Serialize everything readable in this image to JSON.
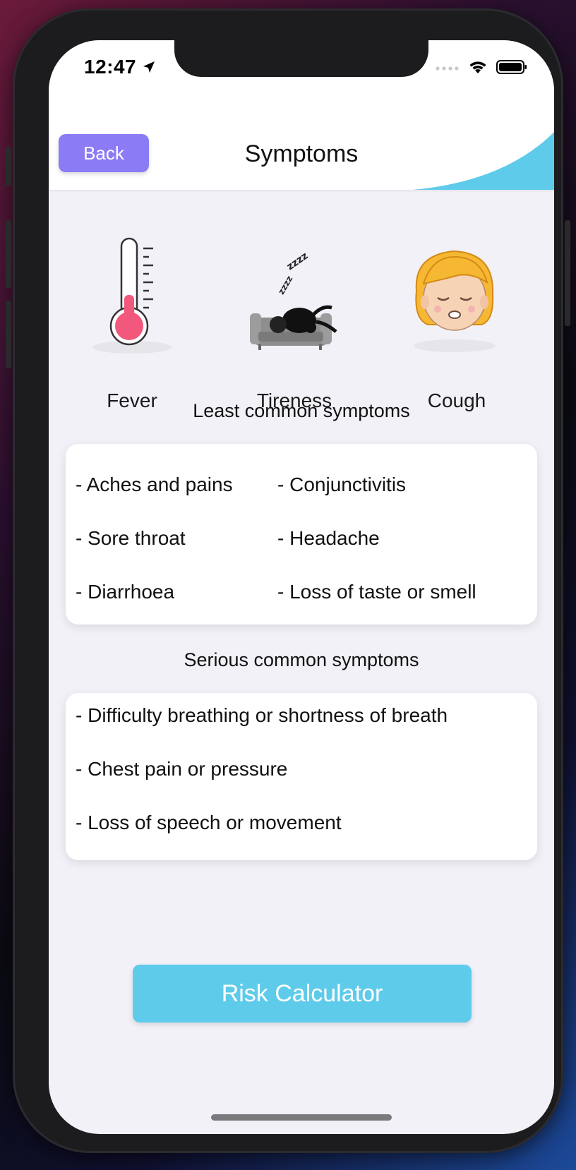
{
  "status_bar": {
    "time": "12:47",
    "icons": [
      "location-arrow-icon",
      "cellular-signal-icon",
      "wifi-icon",
      "battery-icon"
    ]
  },
  "header": {
    "back_label": "Back",
    "title": "Symptoms",
    "accent_color": "#5ecbeb",
    "back_color": "#8b7bf4"
  },
  "common_symptoms": [
    {
      "label": "Fever",
      "icon": "thermometer-icon"
    },
    {
      "label": "Tireness",
      "icon": "tired-on-couch-icon"
    },
    {
      "label": "Cough",
      "icon": "coughing-face-icon"
    }
  ],
  "least_common": {
    "title": "Least common symptoms",
    "items": [
      "- Aches and pains",
      "- Conjunctivitis",
      "- Sore throat",
      "- Headache",
      "- Diarrhoea",
      "- Loss of taste or smell"
    ]
  },
  "serious": {
    "title": "Serious common symptoms",
    "items": [
      "- Difficulty breathing or shortness of breath",
      "- Chest pain or pressure",
      "- Loss of speech or movement"
    ]
  },
  "risk_button_label": "Risk Calculator"
}
